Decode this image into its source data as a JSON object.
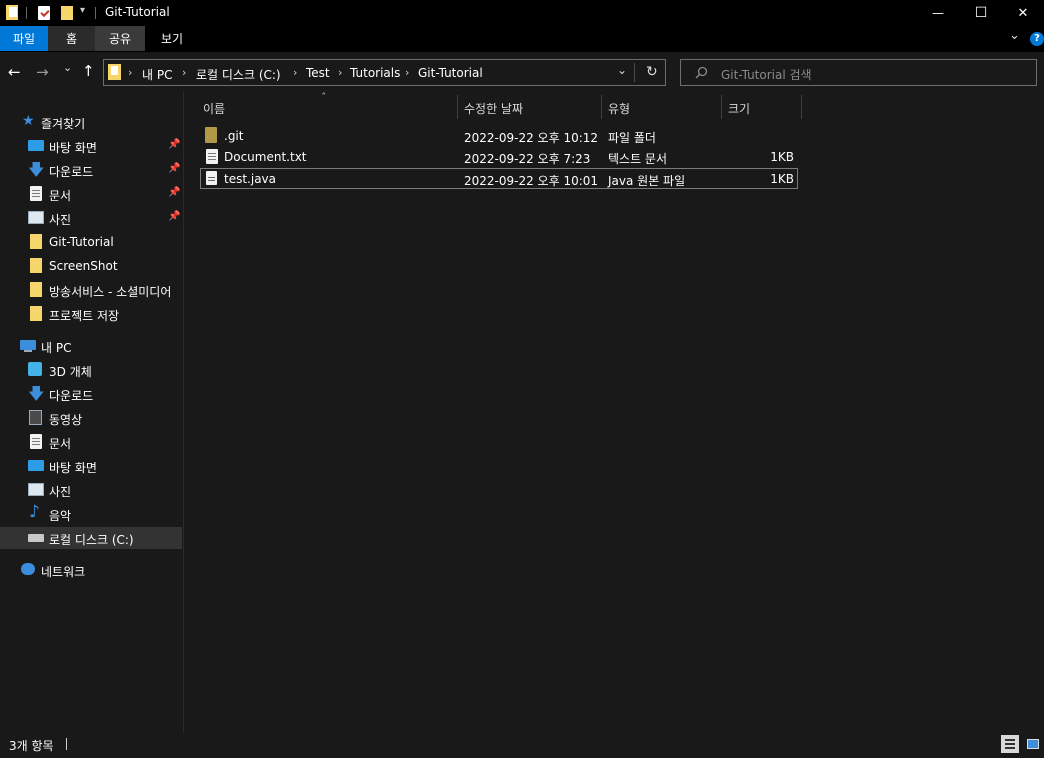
{
  "window": {
    "title": "Git-Tutorial",
    "minimize_glyph": "—",
    "maximize_glyph": "☐",
    "close_glyph": "✕"
  },
  "ribbon": {
    "tabs": [
      {
        "label": "파일",
        "active": true
      },
      {
        "label": "홈"
      },
      {
        "label": "공유"
      },
      {
        "label": "보기"
      }
    ],
    "collapse_glyph": "⌄",
    "help_glyph": "?"
  },
  "nav": {
    "back_glyph": "←",
    "forward_glyph": "→",
    "recent_glyph": "⌄",
    "up_glyph": "↑",
    "breadcrumb": [
      "내 PC",
      "로컬 디스크 (C:)",
      "Test",
      "Tutorials",
      "Git-Tutorial"
    ],
    "separator": "›",
    "dropdown_glyph": "⌄",
    "refresh_glyph": "↻",
    "search_placeholder": "Git-Tutorial 검색"
  },
  "sidebar": {
    "quick_access": {
      "label": "즐겨찾기",
      "items": [
        {
          "label": "바탕 화면",
          "icon": "desktop-icon",
          "pinned": true
        },
        {
          "label": "다운로드",
          "icon": "download-icon",
          "pinned": true
        },
        {
          "label": "문서",
          "icon": "document-icon",
          "pinned": true
        },
        {
          "label": "사진",
          "icon": "pictures-icon",
          "pinned": true
        },
        {
          "label": "Git-Tutorial",
          "icon": "folder-icon"
        },
        {
          "label": "ScreenShot",
          "icon": "folder-icon"
        },
        {
          "label": "방송서비스 - 소셜미디어",
          "icon": "folder-icon"
        },
        {
          "label": "프로젝트 저장",
          "icon": "folder-icon"
        }
      ]
    },
    "this_pc": {
      "label": "내 PC",
      "items": [
        {
          "label": "3D 개체",
          "icon": "3d-objects-icon"
        },
        {
          "label": "다운로드",
          "icon": "download-icon"
        },
        {
          "label": "동영상",
          "icon": "video-icon"
        },
        {
          "label": "문서",
          "icon": "document-icon"
        },
        {
          "label": "바탕 화면",
          "icon": "desktop-icon"
        },
        {
          "label": "사진",
          "icon": "pictures-icon"
        },
        {
          "label": "음악",
          "icon": "music-icon"
        },
        {
          "label": "로컬 디스크 (C:)",
          "icon": "drive-icon",
          "selected": true
        }
      ]
    },
    "network": {
      "label": "네트워크",
      "icon": "network-icon"
    }
  },
  "columns": [
    {
      "label": "이름"
    },
    {
      "label": "수정한 날짜"
    },
    {
      "label": "유형"
    },
    {
      "label": "크기"
    }
  ],
  "sort_glyph": "ˆ",
  "files": [
    {
      "name": ".git",
      "modified": "2022-09-22 오후 10:12",
      "type": "파일 폴더",
      "size": "",
      "icon": "folder-icon"
    },
    {
      "name": "Document.txt",
      "modified": "2022-09-22 오후 7:23",
      "type": "텍스트 문서",
      "size": "1KB",
      "icon": "text-file-icon"
    },
    {
      "name": "test.java",
      "modified": "2022-09-22 오후 10:01",
      "type": "Java 원본 파일",
      "size": "1KB",
      "icon": "java-file-icon",
      "focused": true
    }
  ],
  "status": {
    "count_text": "3개 항목"
  },
  "colors": {
    "background": "#191919",
    "titlebar": "#000000",
    "accent": "#0078d7",
    "selected_nav": "#333333",
    "folder": "#f4d66b"
  }
}
